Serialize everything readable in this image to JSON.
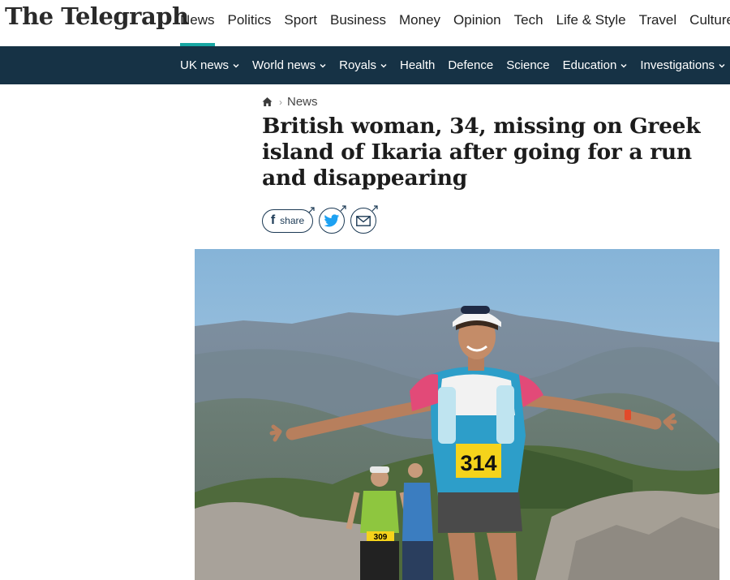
{
  "brand": {
    "logo_text": "The Telegraph"
  },
  "main_nav": {
    "items": [
      {
        "label": "News",
        "active": true
      },
      {
        "label": "Politics"
      },
      {
        "label": "Sport"
      },
      {
        "label": "Business"
      },
      {
        "label": "Money"
      },
      {
        "label": "Opinion"
      },
      {
        "label": "Tech"
      },
      {
        "label": "Life & Style"
      },
      {
        "label": "Travel"
      },
      {
        "label": "Culture"
      }
    ]
  },
  "sub_nav": {
    "items": [
      {
        "label": "UK news",
        "dropdown": true
      },
      {
        "label": "World news",
        "dropdown": true
      },
      {
        "label": "Royals",
        "dropdown": true
      },
      {
        "label": "Health",
        "dropdown": false
      },
      {
        "label": "Defence",
        "dropdown": false
      },
      {
        "label": "Science",
        "dropdown": false
      },
      {
        "label": "Education",
        "dropdown": true
      },
      {
        "label": "Investigations",
        "dropdown": true
      }
    ]
  },
  "breadcrumb": {
    "home_icon": "home-icon",
    "section": "News"
  },
  "article": {
    "headline": "British woman, 34, missing on Greek island of Ikaria after going for a run and disappearing"
  },
  "share": {
    "facebook_letter": "f",
    "facebook_label": "share",
    "twitter_icon": "twitter-bird-icon",
    "email_icon": "envelope-icon"
  },
  "hero_image": {
    "bib_main": "314",
    "bib_secondary": "309"
  },
  "colors": {
    "accent": "#18a7a3",
    "subnav_bg": "#163245",
    "share_border": "#1c3a55",
    "twitter_blue": "#1da1f2"
  }
}
